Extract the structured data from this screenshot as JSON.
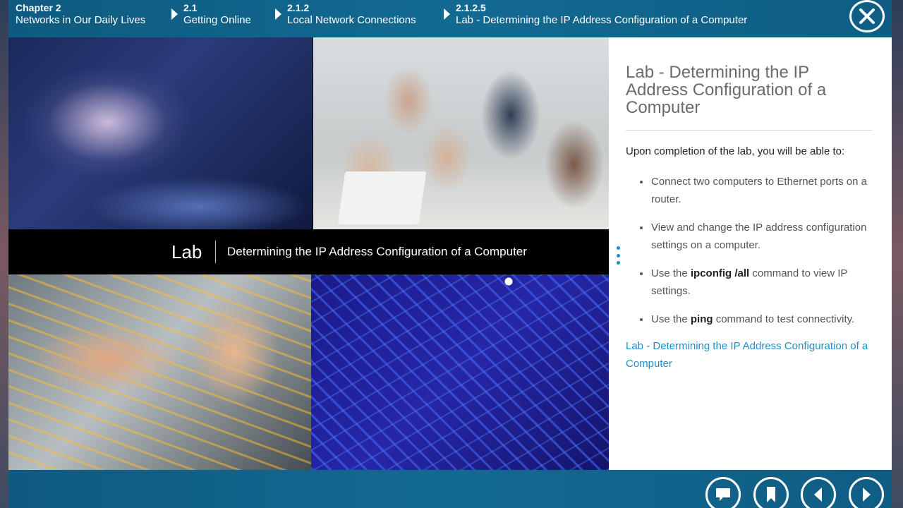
{
  "breadcrumb": [
    {
      "number": "Chapter 2",
      "label": "Networks in Our Daily Lives"
    },
    {
      "number": "2.1",
      "label": "Getting Online"
    },
    {
      "number": "2.1.2",
      "label": "Local Network Connections"
    },
    {
      "number": "2.1.2.5",
      "label": "Lab - Determining the IP Address Configuration of a Computer"
    }
  ],
  "media": {
    "band_label": "Lab",
    "band_title": "Determining the IP Address Configuration of a Computer"
  },
  "panel": {
    "title": "Lab - Determining the IP Address Configuration of a Computer",
    "intro": "Upon completion of the lab, you will be able to:",
    "objectives": [
      {
        "before": "Connect two computers to Ethernet ports on a router.",
        "bold": "",
        "after": ""
      },
      {
        "before": "View and change the IP address configuration settings on a computer.",
        "bold": "",
        "after": ""
      },
      {
        "before": "Use the ",
        "bold": "ipconfig /all",
        "after": " command to view IP settings."
      },
      {
        "before": "Use the ",
        "bold": "ping",
        "after": " command to test connectivity."
      }
    ],
    "link_text": "Lab - Determining the IP Address Configuration of a Computer"
  },
  "controls": {
    "close_icon": "close-icon",
    "comment_icon": "comment-icon",
    "bookmark_icon": "bookmark-icon",
    "previous_icon": "previous-arrow-icon",
    "next_icon": "next-arrow-icon"
  },
  "colors": {
    "bar": "#126a92",
    "link": "#1f8fc6",
    "band": "#000000"
  }
}
